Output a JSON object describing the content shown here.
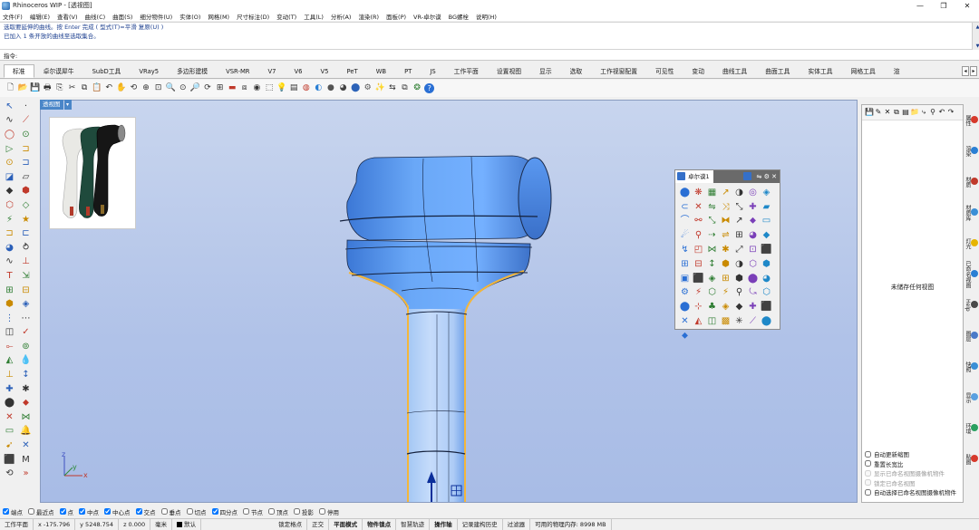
{
  "window": {
    "title": "Rhinoceros WIP - [透视图]",
    "min": "—",
    "max": "❐",
    "close": "✕"
  },
  "menu": [
    "文件(F)",
    "编辑(E)",
    "查看(V)",
    "曲线(C)",
    "曲面(S)",
    "细分物件(U)",
    "实体(O)",
    "网格(M)",
    "尺寸标注(D)",
    "变动(T)",
    "工具(L)",
    "分析(A)",
    "渲染(R)",
    "面板(P)",
    "VR-卓尔谟",
    "BG螺栓",
    "说明(H)"
  ],
  "command_history": [
    "选取要延伸的曲线。按 Enter 完成 ( 型式(T)=平滑  复原(U) )",
    "已加入 1 条开放的曲线至选取集合。"
  ],
  "command_prompt": {
    "label": "指令:",
    "value": ""
  },
  "tabs": [
    "标准",
    "卓尔谟犀牛",
    "SubD工具",
    "VRay5",
    "多边形建模",
    "VSR-MR",
    "V7",
    "V6",
    "V5",
    "PeT",
    "WB",
    "PT",
    "JS",
    "工作平面",
    "设置视图",
    "显示",
    "选取",
    "工作视窗配置",
    "可见性",
    "变动",
    "曲线工具",
    "曲面工具",
    "实体工具",
    "网格工具",
    "渲"
  ],
  "active_tab": "标准",
  "toolbar_icons": [
    {
      "name": "new-icon",
      "g": "🗋",
      "c": "#333"
    },
    {
      "name": "open-icon",
      "g": "📂",
      "c": "#c8962d"
    },
    {
      "name": "save-icon",
      "g": "💾",
      "c": "#3a5fa8"
    },
    {
      "name": "print-icon",
      "g": "🖶",
      "c": "#333"
    },
    {
      "name": "import-icon",
      "g": "⎘",
      "c": "#333"
    },
    {
      "name": "cut-icon",
      "g": "✂",
      "c": "#333"
    },
    {
      "name": "copy-icon",
      "g": "⧉",
      "c": "#333"
    },
    {
      "name": "paste-icon",
      "g": "📋",
      "c": "#a6742c"
    },
    {
      "name": "undo-icon",
      "g": "↶",
      "c": "#333"
    },
    {
      "name": "pan-icon",
      "g": "✋",
      "c": "#8b6b3d"
    },
    {
      "name": "rotate-view-icon",
      "g": "⟲",
      "c": "#333"
    },
    {
      "name": "zoom-extents-icon",
      "g": "⊕",
      "c": "#333"
    },
    {
      "name": "zoom-window-icon",
      "g": "⊡",
      "c": "#333"
    },
    {
      "name": "zoom-icon",
      "g": "🔍",
      "c": "#333"
    },
    {
      "name": "zoom-selected-icon",
      "g": "⊙",
      "c": "#333"
    },
    {
      "name": "zoom-target-icon",
      "g": "🔎",
      "c": "#333"
    },
    {
      "name": "undo-view-icon",
      "g": "⟳",
      "c": "#333"
    },
    {
      "name": "viewport-layout-icon",
      "g": "⊞",
      "c": "#333"
    },
    {
      "name": "cplane-icon",
      "g": "▬",
      "c": "#c0392b"
    },
    {
      "name": "named-cplane-icon",
      "g": "⧈",
      "c": "#333"
    },
    {
      "name": "snapshot-icon",
      "g": "◉",
      "c": "#333"
    },
    {
      "name": "select-icon",
      "g": "⬚",
      "c": "#333"
    },
    {
      "name": "lights-icon",
      "g": "💡",
      "c": "#c9a400"
    },
    {
      "name": "layers-icon",
      "g": "▤",
      "c": "#333"
    },
    {
      "name": "material-icon",
      "g": "◍",
      "c": "#c0392b"
    },
    {
      "name": "color-icon",
      "g": "◐",
      "c": "#2a7fd4"
    },
    {
      "name": "render-icon",
      "g": "●",
      "c": "#555"
    },
    {
      "name": "render-preview-icon",
      "g": "◕",
      "c": "#444"
    },
    {
      "name": "sphere-icon",
      "g": "⬤",
      "c": "#2c63b8"
    },
    {
      "name": "options-icon",
      "g": "⚙",
      "c": "#555"
    },
    {
      "name": "wand-icon",
      "g": "✨",
      "c": "#c9a400"
    },
    {
      "name": "bg-icon",
      "g": "⇆",
      "c": "#333"
    },
    {
      "name": "group-icon",
      "g": "⧉",
      "c": "#333"
    },
    {
      "name": "grasshopper-icon",
      "g": "❂",
      "c": "#2e7d32"
    },
    {
      "name": "help-icon",
      "g": "?",
      "c": "#fff"
    }
  ],
  "left_tools": [
    [
      "↖",
      "·"
    ],
    [
      "∿",
      "⟋"
    ],
    [
      "◯",
      "⊙"
    ],
    [
      "▷",
      "⊐"
    ],
    [
      "⊙",
      "⊐"
    ],
    [
      "◪",
      "▱"
    ],
    [
      "◆",
      "⬢"
    ],
    [
      "⬡",
      "◇"
    ],
    [
      "⚡",
      "★"
    ],
    [
      "⊐",
      "⊏"
    ],
    [
      "◕",
      "⥁"
    ],
    [
      "∿",
      "⊥"
    ],
    [
      "T",
      "⇲"
    ],
    [
      "⊞",
      "⊟"
    ],
    [
      "⬢",
      "◈"
    ],
    [
      "⋮",
      "⋯"
    ],
    [
      "◫",
      "✓"
    ],
    [
      "⟜",
      "⊚"
    ],
    [
      "◭",
      "💧"
    ],
    [
      "⊥",
      "↕"
    ],
    [
      "✚",
      "✱"
    ],
    [
      "⬤",
      "⬥"
    ],
    [
      "✕",
      "⋈"
    ],
    [
      "▭",
      "🔔"
    ],
    [
      "➹",
      "✕"
    ],
    [
      "⬛",
      "M"
    ],
    [
      "⟲",
      "»"
    ]
  ],
  "viewport": {
    "name": "透视图",
    "dropdown": "▾",
    "axis_x": "x",
    "axis_y": "y",
    "axis_z": "z"
  },
  "float_panel": {
    "tab_label": "卓尔谟1",
    "controls": "⇋ ⚙ ✕",
    "icons": [
      "⬤",
      "❋",
      "▦",
      "↗",
      "◑",
      "◎",
      "◈",
      "⊂",
      "✕",
      "⇋",
      "⤨",
      "⤡",
      "✚",
      "▰",
      "⌒",
      "⚯",
      "⤡",
      "⧓",
      "↗",
      "⬥",
      "▭",
      "☄",
      "⚲",
      "⇢",
      "⇌",
      "⊞",
      "◕",
      "◆",
      "↯",
      "◰",
      "⋈",
      "✱",
      "⤢",
      "⊡",
      "⬛",
      "⊞",
      "⊟",
      "↕",
      "⬢",
      "◑",
      "⬡",
      "⬢",
      "▣",
      "⬛",
      "◈",
      "⊞",
      "⬢",
      "⬤",
      "◕",
      "⚙",
      "⚡",
      "⬡",
      "⚡",
      "⚲",
      "⤿",
      "⬡",
      "⬤",
      "⊹",
      "♣",
      "◈",
      "◆",
      "✚",
      "⬛",
      "✕",
      "◭",
      "◫",
      "▩",
      "✳",
      "⟋",
      "⬤",
      "⬥"
    ]
  },
  "right_panel": {
    "toolbar_icons": [
      "💾",
      "✎",
      "✕",
      "⧉",
      "▤",
      "📁",
      "⤷",
      "⚲",
      "↶",
      "↷"
    ],
    "empty_text": "未储存任何视图",
    "options": [
      {
        "label": "自动更新缩图",
        "checked": false,
        "disabled": false
      },
      {
        "label": "重置长宽比",
        "checked": false,
        "disabled": false
      },
      {
        "label": "显示已命名视图摄像机物件",
        "checked": false,
        "disabled": true
      },
      {
        "label": "锁定已命名视图",
        "checked": false,
        "disabled": true
      },
      {
        "label": "自动选择已命名视图摄像机物件",
        "checked": false,
        "disabled": false
      }
    ]
  },
  "right_tabs": [
    {
      "label": "属性",
      "color": "#d6392c"
    },
    {
      "label": "渲染",
      "color": "#2a7fd4"
    },
    {
      "label": "材质",
      "color": "#c0392b"
    },
    {
      "label": "材质库",
      "color": "#3a8fd6"
    },
    {
      "label": "灯光",
      "color": "#e6b400"
    },
    {
      "label": "已命名视图",
      "color": "#2a7fd4"
    },
    {
      "label": "Help",
      "color": "#4a4a4a"
    },
    {
      "label": "图层",
      "color": "#4a7ac8"
    },
    {
      "label": "快照",
      "color": "#3a8fd6"
    },
    {
      "label": "显示",
      "color": "#5aa0e0"
    },
    {
      "label": "环境",
      "color": "#2aa060"
    },
    {
      "label": "贴图",
      "color": "#d6392c"
    }
  ],
  "osnap": [
    {
      "label": "端点",
      "checked": true
    },
    {
      "label": "最近点",
      "checked": false
    },
    {
      "label": "点",
      "checked": true
    },
    {
      "label": "中点",
      "checked": true
    },
    {
      "label": "中心点",
      "checked": true
    },
    {
      "label": "交点",
      "checked": true
    },
    {
      "label": "垂点",
      "checked": false
    },
    {
      "label": "切点",
      "checked": false
    },
    {
      "label": "四分点",
      "checked": true
    },
    {
      "label": "节点",
      "checked": false
    },
    {
      "label": "顶点",
      "checked": false
    },
    {
      "label": "投影",
      "checked": false
    },
    {
      "label": "停用",
      "checked": false
    }
  ],
  "status": {
    "cplane": "工作平面",
    "x": "x -175.796",
    "y": "y 5248.754",
    "z": "z 0.000",
    "units": "毫米",
    "layer": "默认",
    "toggles": [
      "锁定格点",
      "正交",
      "平面模式",
      "物件锁点",
      "智慧轨迹",
      "操作轴",
      "记录建构历史",
      "过滤器"
    ],
    "bold_toggles": [
      "平面模式",
      "物件锁点",
      "操作轴"
    ],
    "memory": "可用的物理内存: 8998 MB"
  },
  "colors": {
    "viewport_top": "#c8d5ee",
    "viewport_bottom": "#a8bce6",
    "model": "#5a98f0",
    "selected_curve": "#f4b63a",
    "viewport_tab": "#4a86c8"
  }
}
